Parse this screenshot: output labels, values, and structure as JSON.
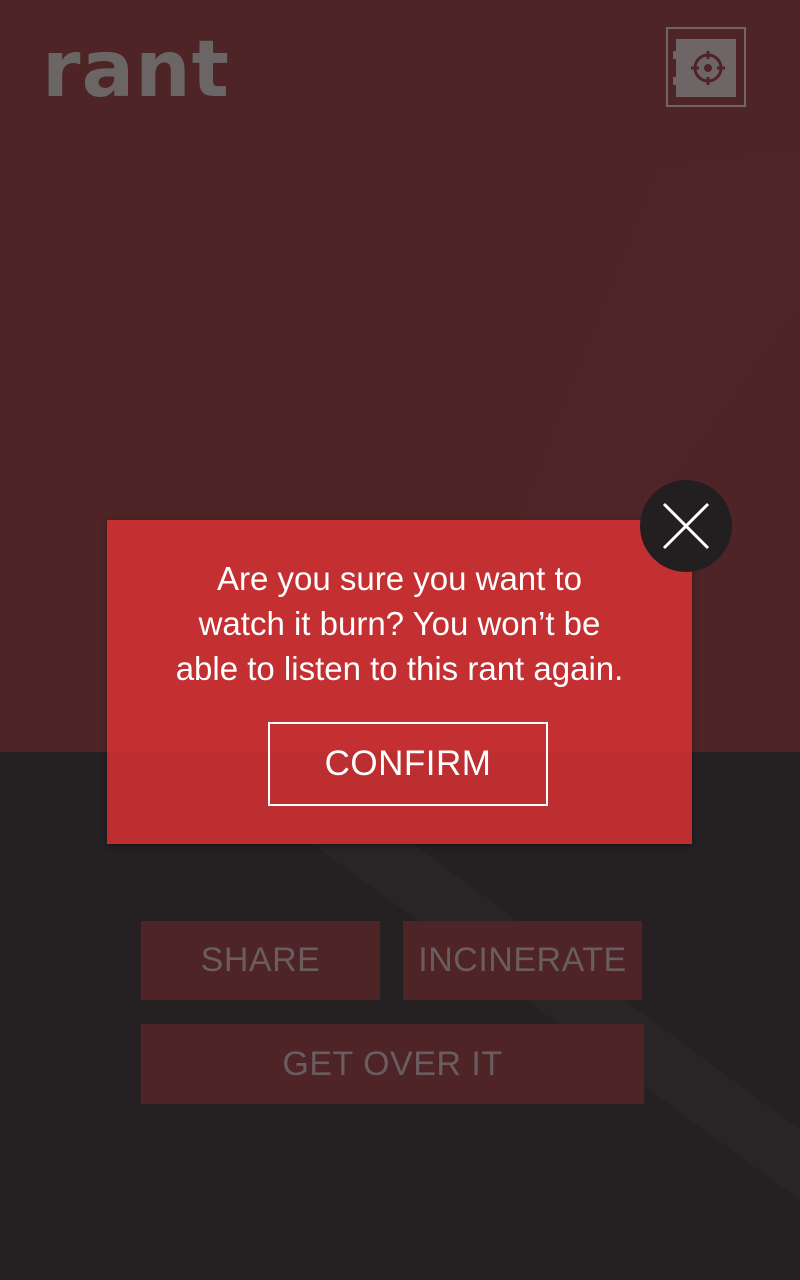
{
  "app": {
    "logo_text": "rant"
  },
  "header": {
    "safe_icon": "safe-icon"
  },
  "actions": {
    "share_label": "SHARE",
    "incinerate_label": "INCINERATE",
    "get_over_it_label": "GET OVER IT"
  },
  "modal": {
    "message": "Are you sure you want to\nwatch it burn? You won’t be\nable to listen to this rant again.",
    "confirm_label": "CONFIRM",
    "close_icon": "close-icon"
  },
  "colors": {
    "top_background": "#4e2426",
    "bottom_background": "#252123",
    "modal_background": "#c43031",
    "close_button_background": "#231f20",
    "dim_text": "#6a5d5f"
  }
}
